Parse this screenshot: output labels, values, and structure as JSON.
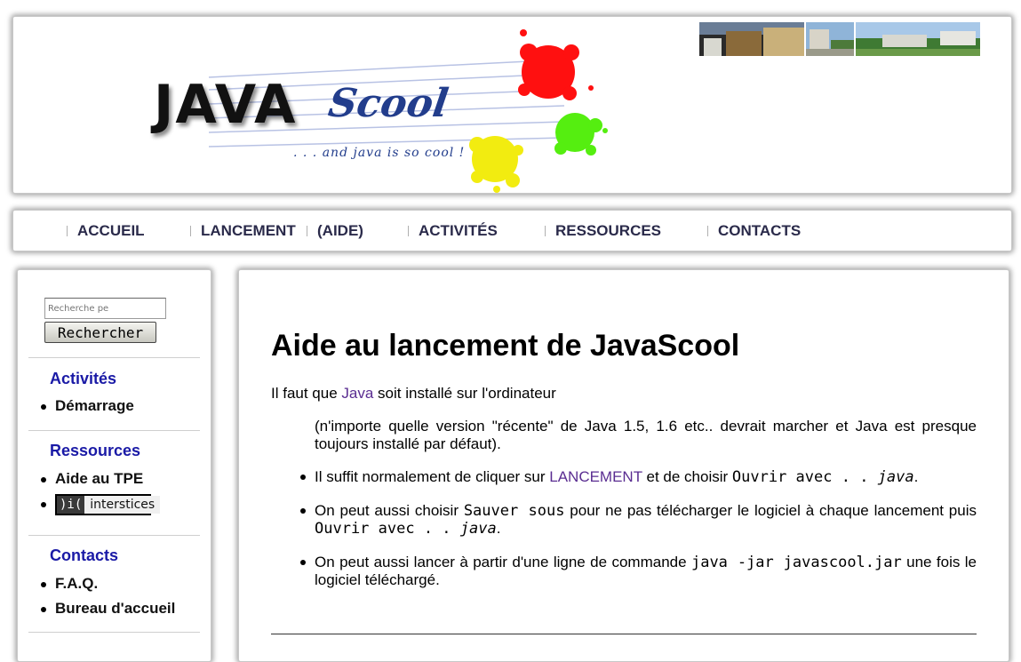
{
  "header": {
    "logo": {
      "word1": "JAVA",
      "word2": "Scool",
      "tagline": ". . . and java is so cool !"
    },
    "photos": [
      "building-photo-1",
      "building-photo-2",
      "building-photo-3"
    ]
  },
  "nav": {
    "items": [
      {
        "label": "ACCUEIL"
      },
      {
        "label": "LANCEMENT"
      },
      {
        "label": "(AIDE)"
      },
      {
        "label": "ACTIVITÉS"
      },
      {
        "label": "RESSOURCES"
      },
      {
        "label": "CONTACTS"
      }
    ]
  },
  "sidebar": {
    "search": {
      "placeholder": "Recherche pe",
      "button_label": "Rechercher",
      "google_icon": "google-logo"
    },
    "sections": [
      {
        "title": "Activités",
        "items": [
          "Démarrage"
        ]
      },
      {
        "title": "Ressources",
        "items": [
          "Aide au TPE"
        ],
        "badge": {
          "mark": ")i(",
          "word": "interstices"
        }
      },
      {
        "title": "Contacts",
        "items": [
          "F.A.Q.",
          "Bureau d'accueil"
        ]
      }
    ]
  },
  "main": {
    "title": "Aide au lancement de JavaScool",
    "intro": {
      "before": "Il faut que ",
      "link": "Java",
      "after": " soit installé sur l'ordinateur"
    },
    "note": "(n'importe quelle version \"récente\" de Java 1.5, 1.6 etc.. devrait marcher et Java est presque toujours installé par défaut).",
    "bullets": [
      {
        "before": "Il suffit normalement de cliquer sur ",
        "link": "LANCEMENT",
        "middle": " et de choisir ",
        "code": "Ouvrir avec . . ",
        "code_italic": "java",
        "after": "."
      },
      {
        "before": "On peut aussi choisir ",
        "code": "Sauver sous",
        "middle": " pour ne pas télécharger le logiciel à chaque lancement puis ",
        "code2": "Ouvrir avec . . ",
        "code2_italic": "java",
        "after": "."
      },
      {
        "before": "On peut aussi lancer à partir d'une ligne de commande ",
        "code": "java -jar javascool.jar",
        "after": " une fois le logiciel téléchargé."
      }
    ]
  },
  "colors": {
    "nav_text": "#2a2a4a",
    "sidebar_title": "#1a1aa6",
    "link": "#5a2d91",
    "logo_blue": "#223d8c"
  }
}
